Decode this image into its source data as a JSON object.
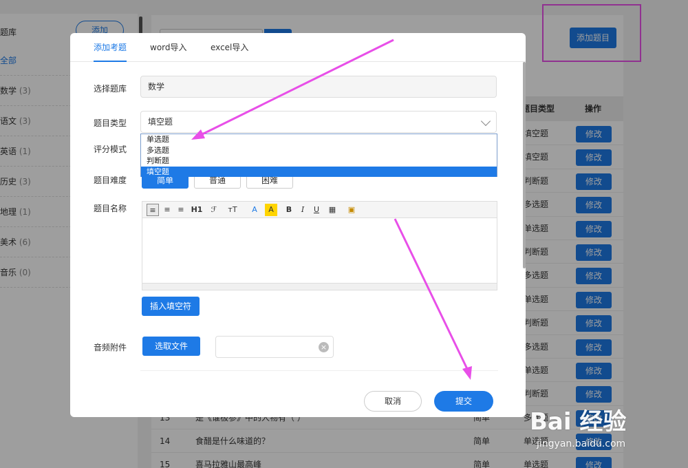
{
  "sidebar": {
    "title": "题库",
    "add_label": "添加",
    "items": [
      {
        "label": "全部",
        "count": ""
      },
      {
        "label": "数学",
        "count": "(3)"
      },
      {
        "label": "语文",
        "count": "(3)"
      },
      {
        "label": "英语",
        "count": "(1)"
      },
      {
        "label": "历史",
        "count": "(3)"
      },
      {
        "label": "地理",
        "count": "(1)"
      },
      {
        "label": "美术",
        "count": "(6)"
      },
      {
        "label": "音乐",
        "count": "(0)"
      }
    ]
  },
  "main": {
    "add_question_label": "添加题目",
    "columns": {
      "type": "题目类型",
      "action": "操作"
    },
    "edit_label": "修改",
    "rows": [
      {
        "no": "",
        "name": "",
        "difficulty": "",
        "type": "填空题"
      },
      {
        "no": "",
        "name": "",
        "difficulty": "",
        "type": "填空题"
      },
      {
        "no": "",
        "name": "",
        "difficulty": "",
        "type": "判断题"
      },
      {
        "no": "",
        "name": "",
        "difficulty": "",
        "type": "多选题"
      },
      {
        "no": "",
        "name": "",
        "difficulty": "",
        "type": "单选题"
      },
      {
        "no": "",
        "name": "",
        "difficulty": "",
        "type": "判断题"
      },
      {
        "no": "",
        "name": "",
        "difficulty": "",
        "type": "多选题"
      },
      {
        "no": "",
        "name": "",
        "difficulty": "",
        "type": "单选题"
      },
      {
        "no": "",
        "name": "",
        "difficulty": "",
        "type": "判断题"
      },
      {
        "no": "",
        "name": "",
        "difficulty": "",
        "type": "多选题"
      },
      {
        "no": "",
        "name": "",
        "difficulty": "",
        "type": "单选题"
      },
      {
        "no": "",
        "name": "",
        "difficulty": "",
        "type": "判断题"
      },
      {
        "no": "13",
        "name": "是《谁极参》中的人物有（ ）",
        "difficulty": "简单",
        "type": "多选题"
      },
      {
        "no": "14",
        "name": "食醋是什么味道的？",
        "difficulty": "简单",
        "type": "单选题"
      },
      {
        "no": "15",
        "name": "喜马拉雅山最高峰",
        "difficulty": "简单",
        "type": "单选题"
      }
    ]
  },
  "modal": {
    "tabs": [
      "添加考题",
      "word导入",
      "excel导入"
    ],
    "bank_label": "选择题库",
    "bank_value": "数学",
    "type_label": "题目类型",
    "type_value": "填空题",
    "type_options": [
      "单选题",
      "多选题",
      "判断题",
      "填空题"
    ],
    "scoring_label": "评分模式",
    "difficulty_label": "题目难度",
    "difficulty_options": [
      "简单",
      "普通",
      "困难"
    ],
    "name_label": "题目名称",
    "toolbar": {
      "h1": "H1",
      "font": "ℱ",
      "size": "тT",
      "bold": "B",
      "italic": "I",
      "underline": "U"
    },
    "insert_blank_label": "插入填空符",
    "audio_label": "音频附件",
    "choose_file_label": "选取文件",
    "cancel_label": "取消",
    "submit_label": "提交"
  },
  "watermark": {
    "brand": "Bai 经验",
    "url": "jingyan.baidu.com"
  },
  "colors": {
    "accent": "#1e7ae6",
    "annotation": "#e84fe8"
  }
}
